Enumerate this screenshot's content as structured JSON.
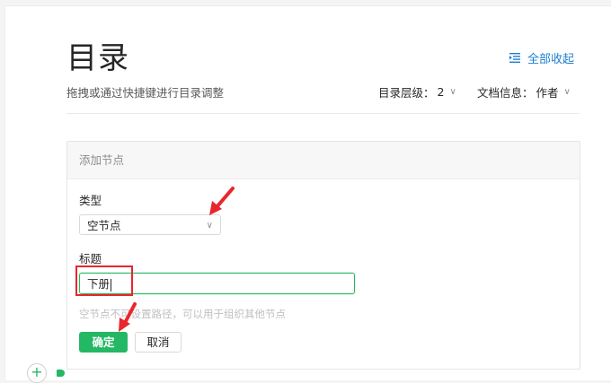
{
  "header": {
    "title": "目录",
    "collapse_all_label": "全部收起",
    "subtitle": "拖拽或通过快捷键进行目录调整",
    "level_label": "目录层级：",
    "level_value": "2",
    "doc_info_label": "文档信息：",
    "doc_info_value": "作者"
  },
  "panel": {
    "heading": "添加节点",
    "type_label": "类型",
    "type_value": "空节点",
    "title_label": "标题",
    "title_value": "下册",
    "hint": "空节点不可设置路径，可以用于组织其他节点",
    "confirm_label": "确定",
    "cancel_label": "取消"
  },
  "icons": {
    "collapse": "collapse-outline-icon",
    "chevron": "chevron-down-icon",
    "add": "plus-icon"
  },
  "colors": {
    "accent": "#25b864",
    "link": "#1e7fd1",
    "annotation": "#e8262b"
  }
}
